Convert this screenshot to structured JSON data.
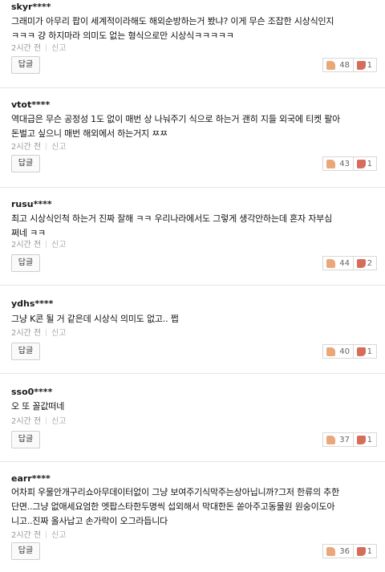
{
  "ui": {
    "reply_label": "답글",
    "report_label": "신고",
    "time": "2시간 전"
  },
  "comments": [
    {
      "user": "skyr****",
      "lines": [
        "그래미가 아무리 팝이 세계적이라해도 해외순방하는거 봤냐? 이게 무슨 조잡한 시상식인지",
        "ㅋㅋㅋ 걍 하지마라 의미도 없는 형식으로만 시상식ㅋㅋㅋㅋㅋ"
      ],
      "likes": "48",
      "dislikes": "1"
    },
    {
      "user": "vtot****",
      "lines": [
        "역대급은 무슨 공정성 1도 없이 매번 상 나눠주기 식으로 하는거 괜히 지들 외국에 티켓 팔아",
        "돈벌고 싶으니 매번 해외에서 하는거지 ㅉㅉ"
      ],
      "likes": "43",
      "dislikes": "1"
    },
    {
      "user": "rusu****",
      "lines": [
        "최고 시상식인척 하는거 진짜 잘해 ㅋㅋ 우리나라에서도 그렇게 생각안하는데 혼자 자부심",
        "쩌네 ㅋㅋ"
      ],
      "likes": "44",
      "dislikes": "2"
    },
    {
      "user": "ydhs****",
      "lines": [
        "그냥 K콘 될 거 같은데 시상식 의미도 없고.. 쩝"
      ],
      "likes": "40",
      "dislikes": "1"
    },
    {
      "user": "sso0****",
      "lines": [
        "오 또 꼴값떠네"
      ],
      "likes": "37",
      "dislikes": "1"
    },
    {
      "user": "earr****",
      "lines": [
        "어차피 우물안개구리쇼아무데이터없이 그냥 보여주기식막주는상아닙니까?그저 한류의 추한",
        "단면..그냥 없애세요엄한 엣팝스타한두명씩 섭외해서 막대한돈 쏟아주고동물원 원숭이도아",
        "니고..진짜 올사납고 손가락이 오그라듭니다"
      ],
      "likes": "36",
      "dislikes": "1"
    }
  ]
}
